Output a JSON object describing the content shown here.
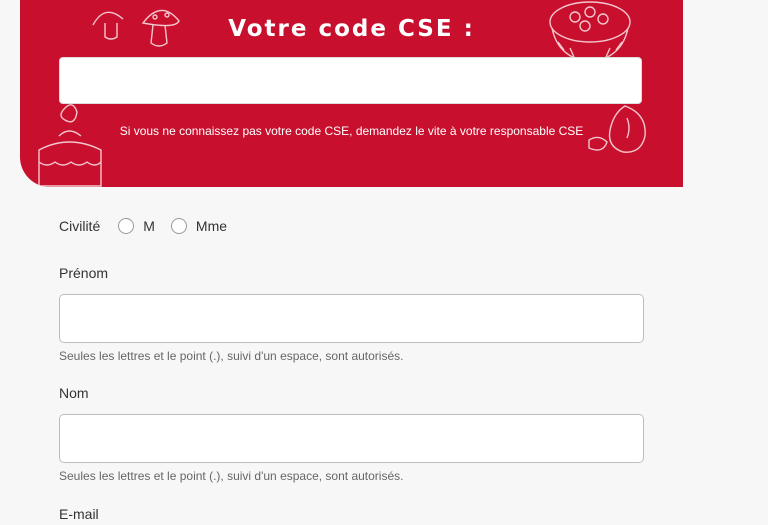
{
  "banner": {
    "title": "Votre code CSE :",
    "code_value": "",
    "hint": "Si vous ne connaissez pas votre code CSE, demandez le vite à votre responsable CSE",
    "background_color": "#c8102e"
  },
  "civilite": {
    "label": "Civilité",
    "options": [
      "M",
      "Mme"
    ]
  },
  "prenom": {
    "label": "Prénom",
    "value": "",
    "help": "Seules les lettres et le point (.), suivi d'un espace, sont autorisés."
  },
  "nom": {
    "label": "Nom",
    "value": "",
    "help": "Seules les lettres et le point (.), suivi d'un espace, sont autorisés."
  },
  "email": {
    "label": "E-mail"
  }
}
